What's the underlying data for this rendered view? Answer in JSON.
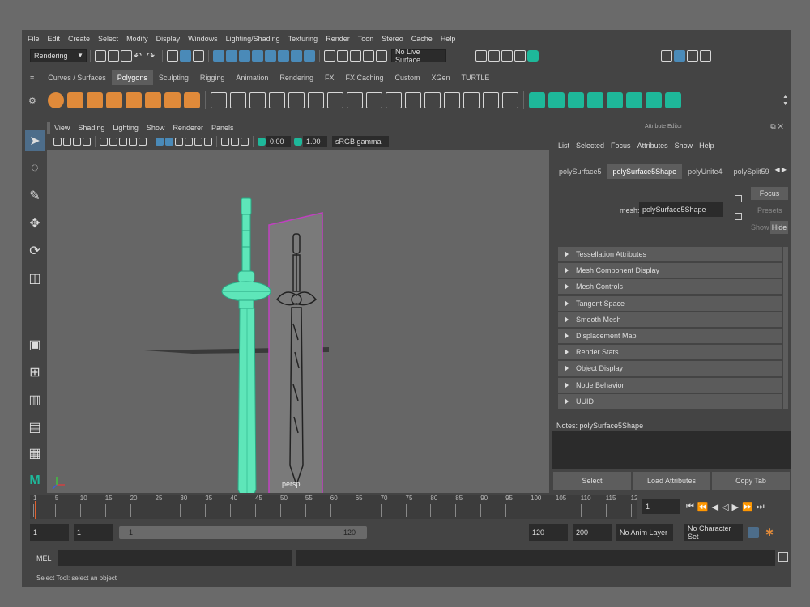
{
  "menu": [
    "File",
    "Edit",
    "Create",
    "Select",
    "Modify",
    "Display",
    "Windows",
    "Lighting/Shading",
    "Texturing",
    "Render",
    "Toon",
    "Stereo",
    "Cache",
    "Help"
  ],
  "toolbar": {
    "menu_set": "Rendering",
    "live_surface": "No Live Surface"
  },
  "shelf_tabs": [
    "Curves / Surfaces",
    "Polygons",
    "Sculpting",
    "Rigging",
    "Animation",
    "Rendering",
    "FX",
    "FX Caching",
    "Custom",
    "XGen",
    "TURTLE"
  ],
  "shelf_active": "Polygons",
  "viewport": {
    "menu": [
      "View",
      "Shading",
      "Lighting",
      "Show",
      "Renderer",
      "Panels"
    ],
    "field1": "0.00",
    "field2": "1.00",
    "color_space": "sRGB gamma",
    "camera_label": "persp"
  },
  "attr": {
    "title": "Attribute Editor",
    "menu": [
      "List",
      "Selected",
      "Focus",
      "Attributes",
      "Show",
      "Help"
    ],
    "tabs": [
      "polySurface5",
      "polySurface5Shape",
      "polyUnite4",
      "polySplit59"
    ],
    "active_tab": "polySurface5Shape",
    "mesh_label": "mesh:",
    "mesh_value": "polySurface5Shape",
    "focus": "Focus",
    "presets": "Presets",
    "show": "Show",
    "hide": "Hide",
    "sections": [
      "Tessellation Attributes",
      "Mesh Component Display",
      "Mesh Controls",
      "Tangent Space",
      "Smooth Mesh",
      "Displacement Map",
      "Render Stats",
      "Object Display",
      "Node Behavior",
      "UUID"
    ],
    "notes": "Notes:  polySurface5Shape",
    "select_btn": "Select",
    "load_btn": "Load Attributes",
    "copy_btn": "Copy Tab"
  },
  "timeline": {
    "ticks": [
      "1",
      "5",
      "10",
      "15",
      "20",
      "25",
      "30",
      "35",
      "40",
      "45",
      "50",
      "55",
      "60",
      "65",
      "70",
      "75",
      "80",
      "85",
      "90",
      "95",
      "100",
      "105",
      "110",
      "115",
      "12"
    ],
    "current_frame": "1"
  },
  "range": {
    "start": "1",
    "start2": "1",
    "slider_start": "1",
    "slider_end": "120",
    "end": "120",
    "end2": "200",
    "anim_layer": "No Anim Layer",
    "char_set": "No Character Set"
  },
  "command": {
    "label": "MEL"
  },
  "status": {
    "help": "Select Tool: select an object"
  },
  "colors": {
    "accent": "#4d6d8a",
    "teal": "#1eb89a",
    "orange": "#e08a3a",
    "magenta": "#c040c0"
  }
}
